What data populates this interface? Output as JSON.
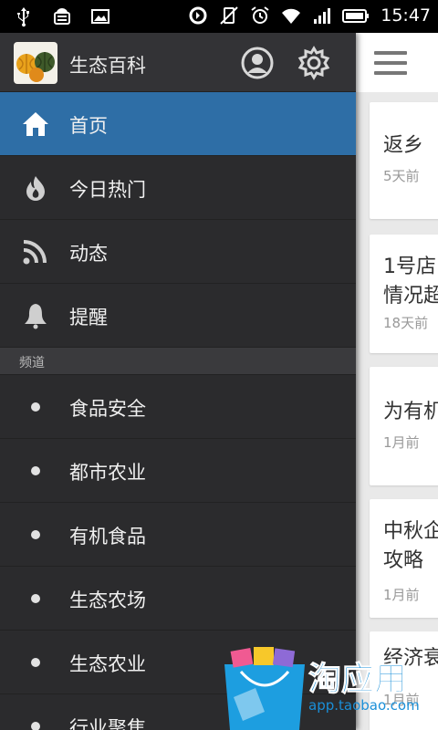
{
  "status_bar": {
    "time": "15:47",
    "icons": [
      "usb-icon",
      "android-debug-icon",
      "image-icon",
      "sync-icon",
      "vibrate-off-icon",
      "alarm-icon",
      "wifi-icon",
      "signal-icon",
      "battery-icon"
    ]
  },
  "drawer": {
    "app_name": "生态百科",
    "header_buttons": [
      "account-icon",
      "settings-gear-icon"
    ],
    "main_items": [
      {
        "label": "首页",
        "icon": "home-icon",
        "active": true
      },
      {
        "label": "今日热门",
        "icon": "fire-icon",
        "active": false
      },
      {
        "label": "动态",
        "icon": "rss-icon",
        "active": false
      },
      {
        "label": "提醒",
        "icon": "bell-icon",
        "active": false
      }
    ],
    "section_header": "频道",
    "channels": [
      {
        "label": "食品安全"
      },
      {
        "label": "都市农业"
      },
      {
        "label": "有机食品"
      },
      {
        "label": "生态农场"
      },
      {
        "label": "生态农业"
      },
      {
        "label": "行业聚焦"
      }
    ]
  },
  "content": {
    "cards": [
      {
        "title": "返乡",
        "time": "5天前"
      },
      {
        "title": "1号店\n情况超",
        "time": "18天前"
      },
      {
        "title": "为有机",
        "time": "1月前"
      },
      {
        "title": "中秋企\n攻略",
        "time": "1月前"
      },
      {
        "title": "经济衰",
        "time": "1月前"
      }
    ]
  },
  "watermark": {
    "brand": "淘应用",
    "url": "app.taobao.com"
  },
  "colors": {
    "accent": "#2e6ea6",
    "drawer_bg": "#2b2b2d",
    "status_bar": "#000000"
  }
}
